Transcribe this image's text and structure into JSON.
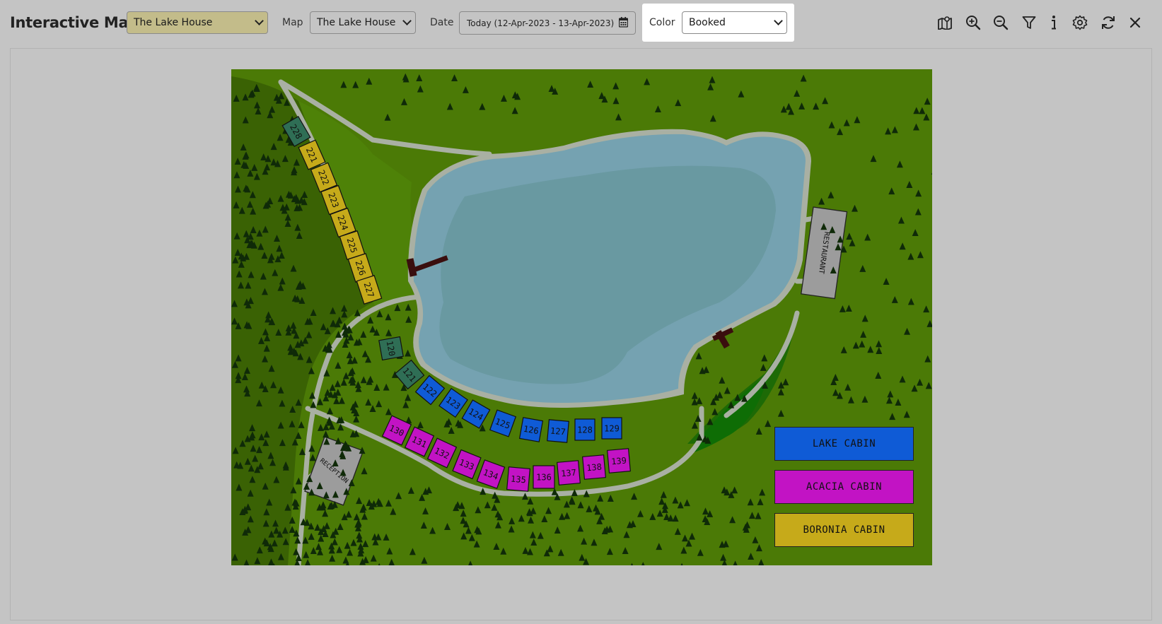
{
  "header": {
    "title": "Interactive Map",
    "property_select": "The Lake House",
    "map_label": "Map",
    "map_select": "The Lake House",
    "date_label": "Date",
    "date_value": "Today (12-Apr-2023 - 13-Apr-2023)",
    "color_label": "Color",
    "color_select": "Booked"
  },
  "toolbar_icons": [
    "map-icon",
    "zoom-in-icon",
    "zoom-out-icon",
    "filter-icon",
    "info-icon",
    "gear-icon",
    "refresh-icon",
    "close-icon"
  ],
  "colors": {
    "lake_cabin": "#0f5bd6",
    "acacia_cabin": "#c213c4",
    "boronia_cabin": "#c6aa1a",
    "booked_dark": "#2f6e55",
    "grass": "#4b7a06",
    "water": "#6798a6"
  },
  "map": {
    "buildings": {
      "restaurant": "RESTAURANT",
      "reception": "RECEPTION"
    },
    "legend": {
      "lake": "LAKE CABIN",
      "acacia": "ACACIA CABIN",
      "boronia": "BORONIA CABIN"
    },
    "boronia_cabins": [
      "228",
      "221",
      "222",
      "223",
      "224",
      "225",
      "226",
      "227"
    ],
    "lake_cabins": [
      "120",
      "121",
      "122",
      "123",
      "124",
      "125",
      "126",
      "127",
      "128",
      "129"
    ],
    "acacia_cabins": [
      "130",
      "131",
      "132",
      "133",
      "134",
      "135",
      "136",
      "137",
      "138",
      "139"
    ]
  }
}
